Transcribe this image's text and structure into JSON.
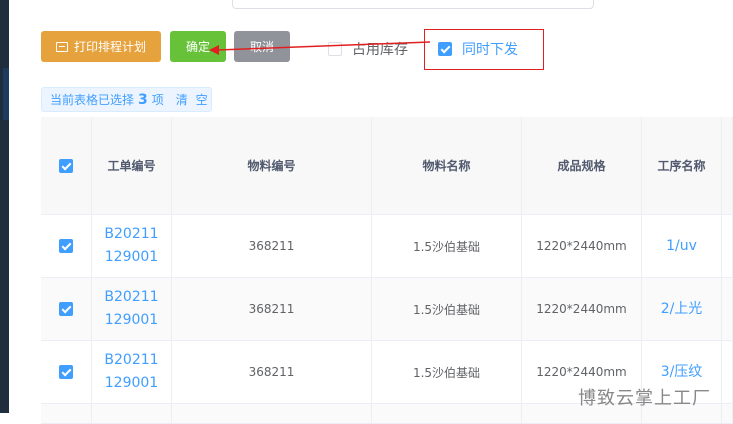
{
  "toolbar": {
    "print_label": "打印排程计划",
    "confirm_label": "确定",
    "cancel_label": "取消"
  },
  "options": {
    "occupy_stock": {
      "label": "占用库存",
      "checked": false
    },
    "issue_together": {
      "label": "同时下发",
      "checked": true
    }
  },
  "selection": {
    "prefix": "当前表格已选择",
    "count": "3",
    "suffix": "项",
    "clear_label": "清 空"
  },
  "table": {
    "columns": [
      "工单编号",
      "物料编号",
      "物料名称",
      "成品规格",
      "工序名称"
    ],
    "rows": [
      {
        "checked": true,
        "order_no": "B20211129001",
        "material_no": "368211",
        "material_name": "1.5沙伯基础",
        "spec": "1220*2440mm",
        "process": "1/uv"
      },
      {
        "checked": true,
        "order_no": "B20211129001",
        "material_no": "368211",
        "material_name": "1.5沙伯基础",
        "spec": "1220*2440mm",
        "process": "2/上光"
      },
      {
        "checked": true,
        "order_no": "B20211129001",
        "material_no": "368211",
        "material_name": "1.5沙伯基础",
        "spec": "1220*2440mm",
        "process": "3/压纹"
      }
    ]
  },
  "watermark": {
    "text": "博致云掌上工厂"
  },
  "colors": {
    "primary": "#409eff",
    "success": "#67c23a",
    "warning": "#e6a23c",
    "info": "#909399",
    "annotation": "#e02020"
  },
  "icons": {
    "print": "printer-icon",
    "check": "checkmark-icon"
  }
}
